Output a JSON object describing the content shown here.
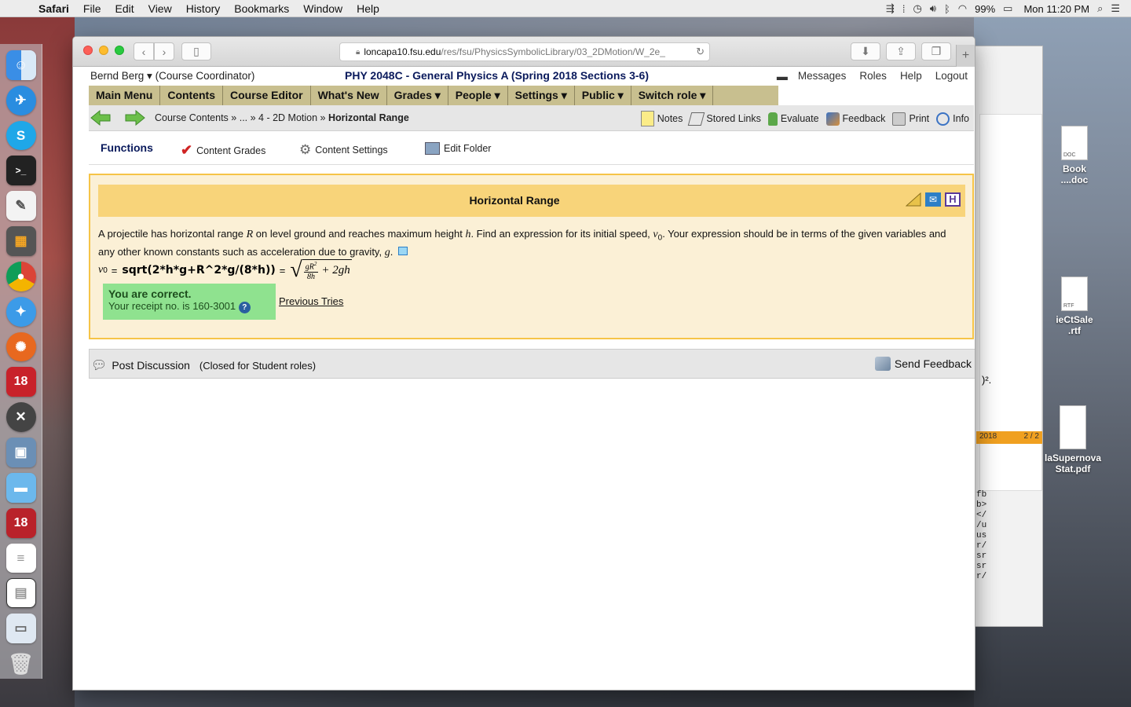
{
  "menubar": {
    "app_name": "Safari",
    "items": [
      "File",
      "Edit",
      "View",
      "History",
      "Bookmarks",
      "Window",
      "Help"
    ],
    "battery": "99%",
    "clock": "Mon 11:20 PM"
  },
  "browser": {
    "url_host": "loncapa10.fsu.edu",
    "url_path": "/res/fsu/PhysicsSymbolicLibrary/03_2DMotion/W_2e_"
  },
  "header": {
    "user": "Bernd Berg",
    "role": "(Course Coordinator)",
    "course_title": "PHY 2048C - General Physics A (Spring 2018 Sections 3-6)",
    "links": [
      "Messages",
      "Roles",
      "Help",
      "Logout"
    ]
  },
  "main_menu": [
    "Main Menu",
    "Contents",
    "Course Editor",
    "What's New",
    "Grades ▾",
    "People ▾",
    "Settings ▾",
    "Public ▾",
    "Switch role ▾"
  ],
  "breadcrumb": {
    "part1": "Course Contents »",
    "part2": "... »",
    "part3": "4 - 2D Motion »",
    "current": "Horizontal Range"
  },
  "nav_tools": [
    "Notes",
    "Stored Links",
    "Evaluate",
    "Feedback",
    "Print",
    "Info"
  ],
  "functions": {
    "title": "Functions",
    "content_grades": "Content Grades",
    "content_settings": "Content Settings",
    "edit_folder": "Edit Folder"
  },
  "problem": {
    "title": "Horizontal Range",
    "text_a": "A projectile has horizontal range ",
    "var_R": "R",
    "text_b": " on level ground and reaches maximum height ",
    "var_h": "h",
    "text_c": ". Find an expression for its initial speed, ",
    "var_v0": "v",
    "sub0": "0",
    "text_d": ". Your expression should be in terms of the given variables and any other known constants such as acceleration due to gravity, ",
    "var_g": "g",
    "text_e": ".",
    "answer_var": "v",
    "answer_input": "sqrt(2*h*g+R^2*g/(8*h))",
    "frac_num": "gR",
    "frac_sup": "2",
    "frac_den": "8h",
    "sqrt_tail": "+ 2gh",
    "correct_msg": "You are correct.",
    "receipt": "Your receipt no. is 160-3001",
    "previous_tries": "Previous Tries"
  },
  "discussion": {
    "post": "Post Discussion",
    "closed": "(Closed for Student roles)",
    "send_feedback": "Send Feedback"
  },
  "desktop_files": [
    {
      "line1": "Book",
      "line2": "....doc",
      "tag": "DOC"
    },
    {
      "line1": "ieCtSale",
      "line2": ".rtf",
      "tag": "RTF"
    },
    {
      "line1": "laSupernova",
      "line2": "Stat.pdf",
      "tag": ""
    }
  ],
  "bg_window": {
    "footer_left": "2018",
    "footer_right": "2 / 2",
    "fragment": ")².",
    "code_lines": [
      "fb",
      "b>",
      "</",
      "/u",
      "us",
      "r/",
      "sr",
      "sr",
      "r/"
    ]
  },
  "dock_badges": [
    "18",
    "18"
  ],
  "colors": {
    "menu_bar_bg": "#c8bf8f",
    "problem_bg": "#fbf0d6",
    "problem_border": "#f6c447",
    "problem_header": "#f8d47a",
    "correct_bg": "#8fe28f",
    "title_blue": "#0a1a5c"
  }
}
